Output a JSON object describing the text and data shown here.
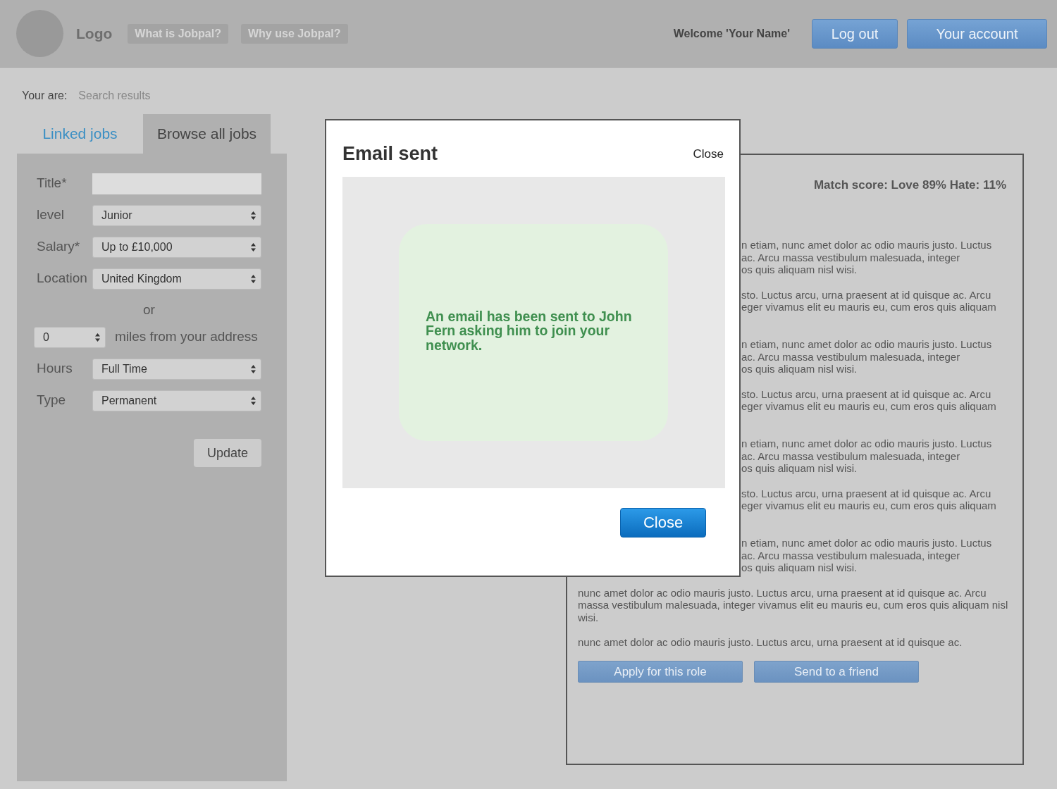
{
  "header": {
    "logo": "Logo",
    "nav": [
      "What is Jobpal?",
      "Why use Jobpal?"
    ],
    "welcome": "Welcome 'Your Name'",
    "buttons": [
      "Log out",
      "Your account"
    ]
  },
  "breadcrumb": {
    "label": "Your are:",
    "current": "Search results"
  },
  "tabs": [
    {
      "label": "Linked jobs",
      "selected": false
    },
    {
      "label": "Browse all jobs",
      "selected": true
    }
  ],
  "filters": [
    {
      "kind": "text",
      "label": "Title*"
    },
    {
      "kind": "select",
      "label": "level",
      "value": "Junior"
    },
    {
      "kind": "select",
      "label": "Salary*",
      "value": "Up to £10,000"
    },
    {
      "kind": "select",
      "label": "Location",
      "value": "United Kingdom"
    },
    {
      "kind": "separator",
      "label": "or"
    },
    {
      "kind": "distance",
      "value": "0",
      "label": "miles from your address"
    },
    {
      "kind": "select",
      "label": "Hours",
      "value": "Full Time"
    },
    {
      "kind": "select",
      "label": "Type",
      "value": "Permanent"
    }
  ],
  "update_button": "Update",
  "job_panel": {
    "match_score": "Match score: Love 89% Hate: 11%",
    "paragraphs": [
      {
        "kind": "fragment",
        "text": "n etiam, nunc amet dolor ac odio mauris justo. Luctus\nac. Arcu massa vestibulum malesuada, integer\nos quis aliquam nisl wisi."
      },
      {
        "kind": "fragment",
        "text": "sto. Luctus arcu, urna praesent at id quisque ac. Arcu\neger vivamus elit eu mauris eu, cum eros quis aliquam"
      },
      {
        "kind": "fragment",
        "text": "n etiam, nunc amet dolor ac odio mauris justo. Luctus\nac. Arcu massa vestibulum malesuada, integer\nos quis aliquam nisl wisi."
      },
      {
        "kind": "fragment",
        "text": "sto. Luctus arcu, urna praesent at id quisque ac. Arcu\neger vivamus elit eu mauris eu, cum eros quis aliquam"
      },
      {
        "kind": "fragment",
        "text": "n etiam, nunc amet dolor ac odio mauris justo. Luctus\nac. Arcu massa vestibulum malesuada, integer\nos quis aliquam nisl wisi."
      },
      {
        "kind": "fragment",
        "text": "sto. Luctus arcu, urna praesent at id quisque ac. Arcu\neger vivamus elit eu mauris eu, cum eros quis aliquam"
      },
      {
        "kind": "fragment",
        "text": "n etiam, nunc amet dolor ac odio mauris justo. Luctus\nac. Arcu massa vestibulum malesuada, integer\nos quis aliquam nisl wisi."
      },
      {
        "kind": "full",
        "text": "nunc amet dolor ac odio mauris justo. Luctus arcu, urna praesent at id quisque ac. Arcu massa vestibulum malesuada, integer vivamus elit eu mauris eu, cum eros quis aliquam nisl wisi."
      },
      {
        "kind": "full",
        "text": "nunc amet dolor ac odio mauris justo. Luctus arcu, urna praesent at id quisque ac."
      }
    ],
    "buttons": [
      "Apply for this role",
      "Send to a friend"
    ]
  },
  "modal": {
    "title": "Email sent",
    "close_link": "Close",
    "message": "An email has been sent to John Fern asking him to join your network.",
    "button": "Close"
  }
}
